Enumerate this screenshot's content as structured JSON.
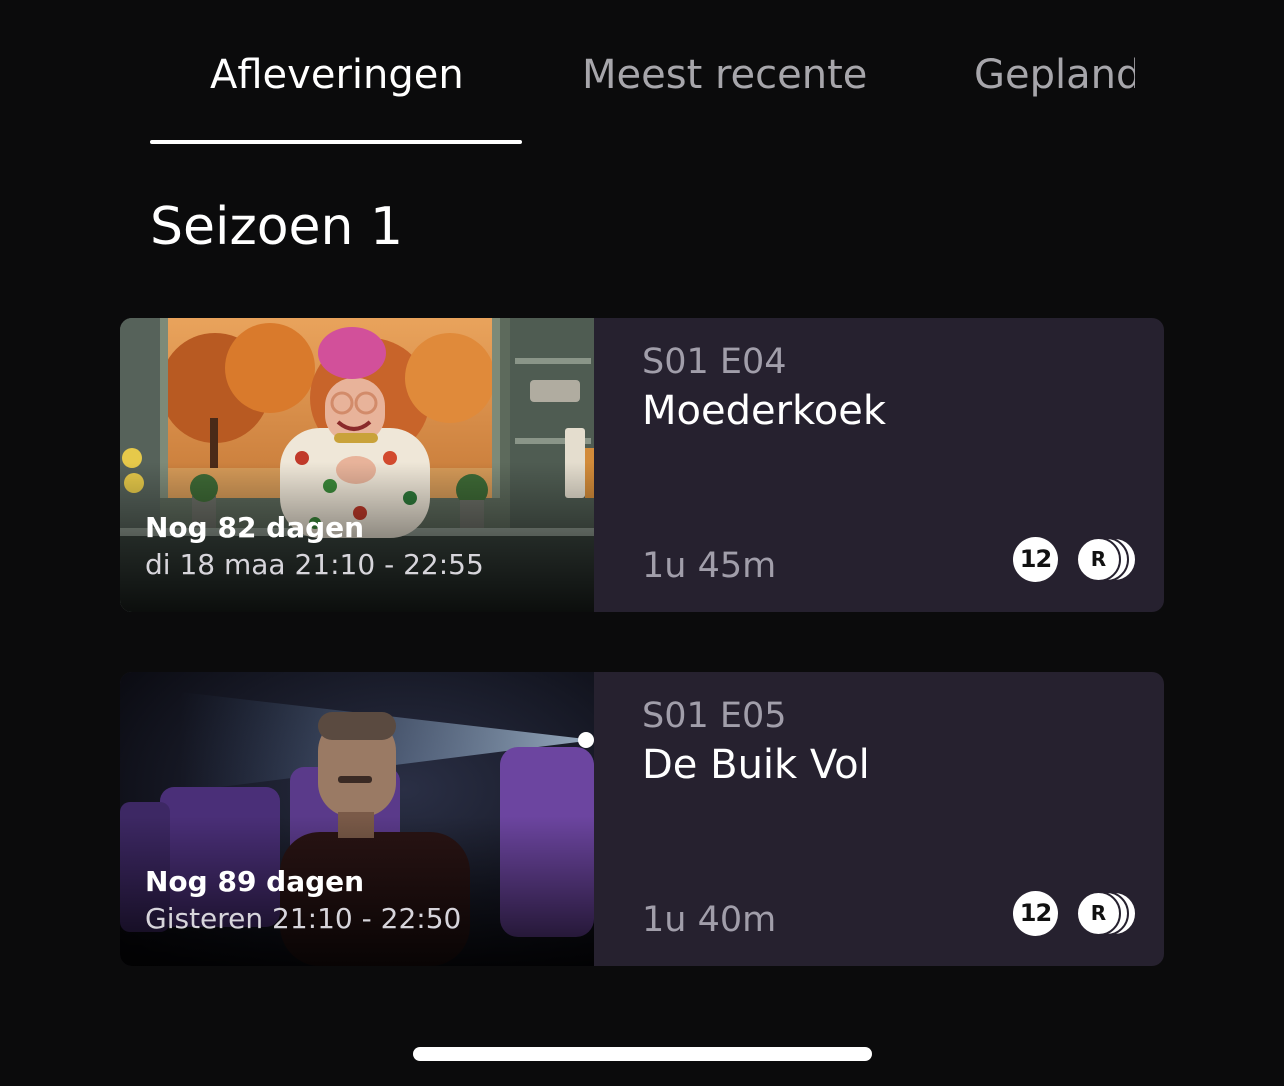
{
  "tabs": [
    {
      "label": "Afleveringen",
      "active": true
    },
    {
      "label": "Meest recente",
      "active": false
    },
    {
      "label": "Gepland",
      "active": false
    }
  ],
  "season": {
    "title": "Seizoen 1"
  },
  "episodes": [
    {
      "code": "S01 E04",
      "title": "Moederkoek",
      "duration": "1u 45m",
      "countdown": "Nog 82 dagen",
      "airtime": "di 18 maa  21:10 - 22:55",
      "age_rating": "12",
      "rerun_badge": "R",
      "thumbnail_icon": "cooking-show-thumbnail"
    },
    {
      "code": "S01 E05",
      "title": "De Buik Vol",
      "duration": "1u 40m",
      "countdown": "Nog 89 dagen",
      "airtime": "Gisteren  21:10 - 22:50",
      "age_rating": "12",
      "rerun_badge": "R",
      "thumbnail_icon": "cinema-thumbnail"
    }
  ],
  "colors": {
    "background": "#0b0b0c",
    "card_background": "#26212f",
    "secondary_text": "#a19eaa",
    "active_tab": "#ffffff",
    "inactive_tab": "#a7a6ab"
  }
}
